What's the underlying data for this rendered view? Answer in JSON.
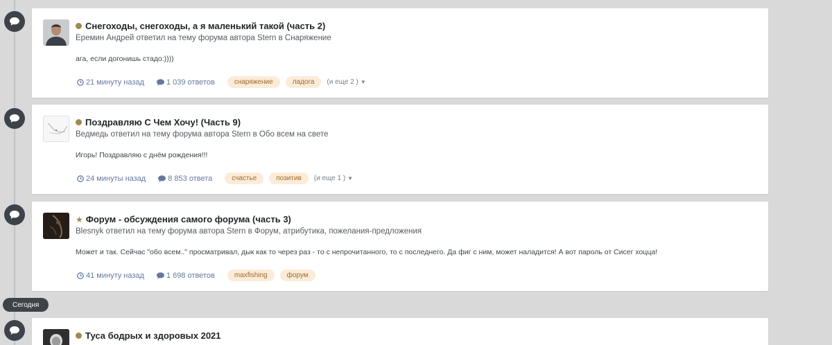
{
  "colors": {
    "accent": "#a08a50",
    "tag_bg": "#fbecd9",
    "tag_text": "#9b6a2b",
    "meta": "#65799e",
    "stream_icon": "#3d4349"
  },
  "icons": {
    "stream": "speech-bubble-icon",
    "time": "clock-icon",
    "replies": "comment-icon",
    "pinned": "star-icon",
    "unread": "dot-icon"
  },
  "separator": {
    "label": "Сегодня"
  },
  "posts": [
    {
      "title": "Снегоходы, снегоходы, а я маленький такой (часть 2)",
      "subtitle": "Еремин Андрей ответил на тему форума автора Stern в Снаряжение",
      "snippet": "ага, если догонишь стадо:))))",
      "time": "21 минуту назад",
      "replies": "1 039 ответов",
      "tags": [
        "снаряжение",
        "ладога"
      ],
      "more": "(и еще 2 )"
    },
    {
      "title": "Поздравляю С Чем Хочу! (Часть 9)",
      "subtitle": "Ведмедь ответил на тему форума автора Stern в Обо всем на свете",
      "snippet": "Игорь! Поздравляю с днём рождения!!!",
      "time": "24 минуты назад",
      "replies": "8 853 ответа",
      "tags": [
        "счастье",
        "позитив"
      ],
      "more": "(и еще 1 )"
    },
    {
      "title": "Форум - обсуждения самого форума (часть 3)",
      "subtitle": "Blesnyk ответил на тему форума автора Stern в Форум, атрибутика, пожелания-предложения",
      "snippet": "Может и так. Сейчас \"обо всем..\" просматривал, дык как то через раз - то с непрочитанного, то с последнего. Да фиг с ним, может наладится! А вот пароль от Сисег хоцца!",
      "time": "41 минуту назад",
      "replies": "1 698 ответов",
      "tags": [
        "maxfishing",
        "форум"
      ]
    },
    {
      "title": "Туса бодрых и здоровых 2021"
    }
  ]
}
